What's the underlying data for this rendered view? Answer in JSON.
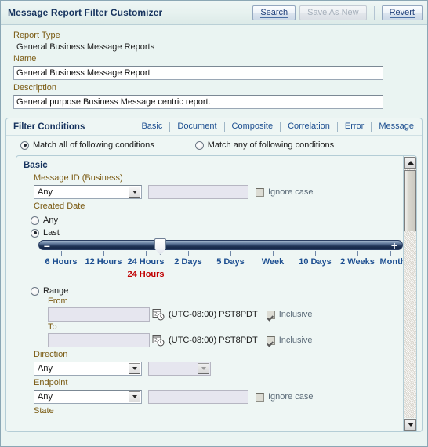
{
  "window": {
    "title": "Message Report Filter Customizer"
  },
  "toolbar": {
    "search_label": "Search",
    "save_as_new_label": "Save As New",
    "revert_label": "Revert"
  },
  "report": {
    "report_type_label": "Report Type",
    "report_type_value": "General Business Message Reports",
    "name_label": "Name",
    "name_value": "General Business Message Report",
    "description_label": "Description",
    "description_value": "General purpose Business Message centric report."
  },
  "filter_conditions": {
    "title": "Filter Conditions",
    "tabs": [
      {
        "label": "Basic",
        "active": true
      },
      {
        "label": "Document",
        "active": false
      },
      {
        "label": "Composite",
        "active": false
      },
      {
        "label": "Correlation",
        "active": false
      },
      {
        "label": "Error",
        "active": false
      },
      {
        "label": "Message",
        "active": false
      }
    ],
    "match_all_label": "Match all of following conditions",
    "match_any_label": "Match any of following conditions",
    "match_mode": "all"
  },
  "basic_panel": {
    "title": "Basic",
    "message_id": {
      "label": "Message ID (Business)",
      "operator_value": "Any",
      "value": "",
      "ignore_case_label": "Ignore case",
      "ignore_case_checked": false
    },
    "created_date": {
      "label": "Created Date",
      "any_label": "Any",
      "last_label": "Last",
      "range_label": "Range",
      "selected": "Last",
      "slider": {
        "ticks": [
          "6 Hours",
          "12 Hours",
          "24 Hours",
          "2 Days",
          "5 Days",
          "Week",
          "10 Days",
          "2 Weeks",
          "Month"
        ],
        "selected_index": 2,
        "current_value": "24 Hours",
        "decrement_icon": "minus-icon",
        "increment_icon": "plus-icon"
      },
      "from_label": "From",
      "from_value": "",
      "from_timezone": "(UTC-08:00) PST8PDT",
      "from_inclusive_label": "Inclusive",
      "from_inclusive_checked": true,
      "to_label": "To",
      "to_value": "",
      "to_timezone": "(UTC-08:00) PST8PDT",
      "to_inclusive_label": "Inclusive",
      "to_inclusive_checked": true
    },
    "direction": {
      "label": "Direction",
      "operator_value": "Any",
      "value": ""
    },
    "endpoint": {
      "label": "Endpoint",
      "operator_value": "Any",
      "value": "",
      "ignore_case_label": "Ignore case",
      "ignore_case_checked": false
    },
    "state": {
      "label": "State"
    }
  },
  "scrollbar": {
    "up_icon": "scroll-up-arrow-icon",
    "down_icon": "scroll-down-arrow-icon"
  }
}
